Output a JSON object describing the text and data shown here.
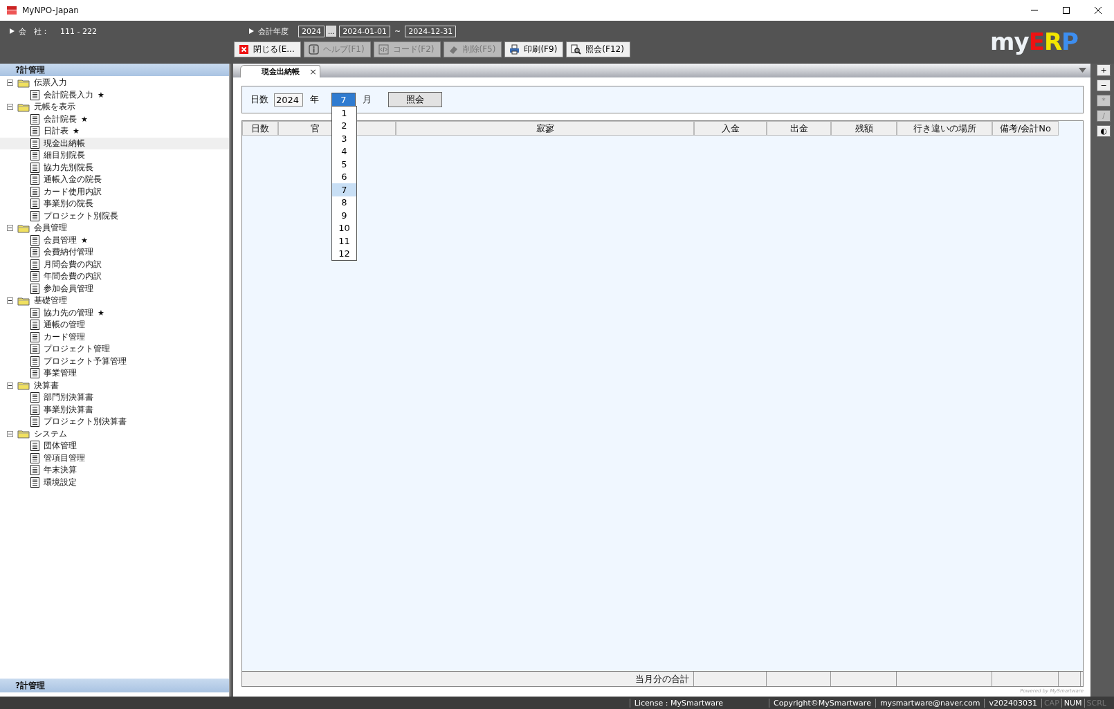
{
  "window": {
    "title": "MyNPO-Japan"
  },
  "header": {
    "company_label": "会　社：",
    "company_value": "111 - 222",
    "fiscal_label": "会計年度",
    "fiscal_year": "2024",
    "fiscal_button": "...",
    "date_from": "2024-01-01",
    "date_separator": "~",
    "date_to": "2024-12-31"
  },
  "logo": [
    {
      "text": "my",
      "color": "#eef2f6"
    },
    {
      "text": "E",
      "color": "#ee1111"
    },
    {
      "text": "R",
      "color": "#f2e600"
    },
    {
      "text": "P",
      "color": "#3d8ef0"
    }
  ],
  "toolbar": [
    {
      "kind": "close",
      "label": "閉じる(E...",
      "disabled": false
    },
    {
      "kind": "info",
      "label": "ヘルプ(F1)",
      "disabled": true
    },
    {
      "kind": "code",
      "label": "コード(F2)",
      "disabled": true
    },
    {
      "kind": "erase",
      "label": "削除(F5)",
      "disabled": true
    },
    {
      "kind": "print",
      "label": "印刷(F9)",
      "disabled": false
    },
    {
      "kind": "query",
      "label": "照会(F12)",
      "disabled": false
    }
  ],
  "sidebar": {
    "title": "?計管理",
    "footer": "?計管理",
    "tree": [
      {
        "label": "伝票入力",
        "expanded": true,
        "children": [
          {
            "label": "会計院長入力",
            "badge": "★",
            "selected": false
          }
        ]
      },
      {
        "label": "元帳を表示",
        "expanded": true,
        "children": [
          {
            "label": "会計院長",
            "badge": "★",
            "selected": false
          },
          {
            "label": "日計表",
            "badge": "★",
            "selected": false
          },
          {
            "label": "現金出納帳",
            "selected": true
          },
          {
            "label": "細目別院長",
            "selected": false
          },
          {
            "label": "協力先別院長",
            "selected": false
          },
          {
            "label": "通帳入金の院長",
            "selected": false
          },
          {
            "label": "カード使用内訳",
            "selected": false
          },
          {
            "label": "事業別の院長",
            "selected": false
          },
          {
            "label": "プロジェクト別院長",
            "selected": false
          }
        ]
      },
      {
        "label": "会員管理",
        "expanded": true,
        "children": [
          {
            "label": "会員管理",
            "badge": "★",
            "selected": false
          },
          {
            "label": "会費納付管理",
            "selected": false
          },
          {
            "label": "月間会費の内訳",
            "selected": false
          },
          {
            "label": "年間会費の内訳",
            "selected": false
          },
          {
            "label": "参加会員管理",
            "selected": false
          }
        ]
      },
      {
        "label": "基礎管理",
        "expanded": true,
        "children": [
          {
            "label": "協力先の管理",
            "badge": "★",
            "selected": false
          },
          {
            "label": "通帳の管理",
            "selected": false
          },
          {
            "label": "カード管理",
            "selected": false
          },
          {
            "label": "プロジェクト管理",
            "selected": false
          },
          {
            "label": "プロジェクト予算管理",
            "selected": false
          },
          {
            "label": "事業管理",
            "selected": false
          }
        ]
      },
      {
        "label": "決算書",
        "expanded": true,
        "children": [
          {
            "label": "部門別決算書",
            "selected": false
          },
          {
            "label": "事業別決算書",
            "selected": false
          },
          {
            "label": "プロジェクト別決算書",
            "selected": false
          }
        ]
      },
      {
        "label": "システム",
        "expanded": true,
        "children": [
          {
            "label": "団体管理",
            "selected": false
          },
          {
            "label": "管項目管理",
            "selected": false
          },
          {
            "label": "年末決算",
            "selected": false
          },
          {
            "label": "環境設定",
            "selected": false
          }
        ]
      }
    ]
  },
  "tabs": [
    {
      "label": "現金出納帳",
      "close": "×",
      "selected": true
    }
  ],
  "filter": {
    "label": "日数",
    "year": "2024",
    "year_unit": "年",
    "month": "7",
    "month_unit": "月",
    "query_button": "照会",
    "month_options": [
      {
        "label": "1",
        "selected": false
      },
      {
        "label": "2",
        "selected": false
      },
      {
        "label": "3",
        "selected": false
      },
      {
        "label": "4",
        "selected": false
      },
      {
        "label": "5",
        "selected": false
      },
      {
        "label": "6",
        "selected": false
      },
      {
        "label": "7",
        "selected": true
      },
      {
        "label": "8",
        "selected": false
      },
      {
        "label": "9",
        "selected": false
      },
      {
        "label": "10",
        "selected": false
      },
      {
        "label": "11",
        "selected": false
      },
      {
        "label": "12",
        "selected": false
      }
    ]
  },
  "table": {
    "columns": [
      "日数",
      "官",
      "寂寥",
      "入金",
      "出金",
      "残額",
      "行き違いの場所",
      "備考/会計No"
    ],
    "footer_label": "当月分の合計"
  },
  "powered_by": "Powered by MySmartware",
  "side_tools": [
    {
      "label": "+",
      "disabled": false
    },
    {
      "label": "−",
      "disabled": false
    },
    {
      "label": "*",
      "disabled": true
    },
    {
      "label": "/",
      "disabled": true
    },
    {
      "label": "◐",
      "disabled": false
    }
  ],
  "status_bar": {
    "items": [
      "License : MySmartware",
      "Copyright©MySmartware",
      "mysmartware@naver.com",
      "v202403031"
    ],
    "indicators": [
      {
        "label": "CAP",
        "on": false
      },
      {
        "label": "NUM",
        "on": true
      },
      {
        "label": "SCRL",
        "on": false
      }
    ]
  }
}
